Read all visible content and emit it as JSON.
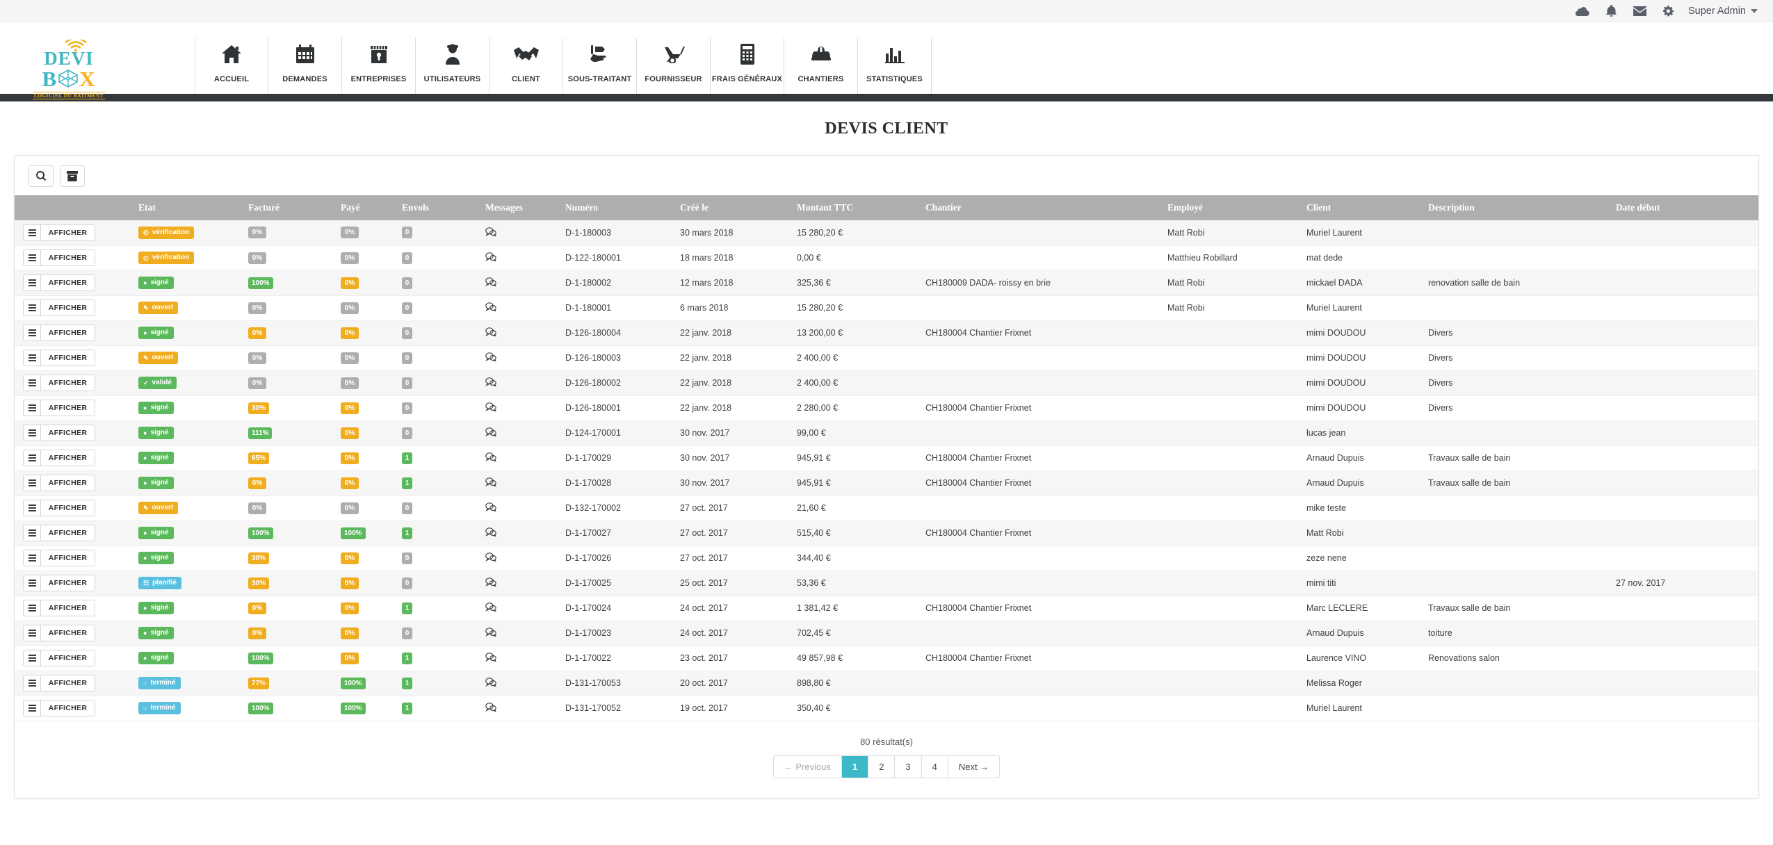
{
  "topbar": {
    "icons": [
      "cloud-icon",
      "bell-icon",
      "envelope-icon",
      "gear-icon"
    ],
    "user_label": "Super Admin"
  },
  "brand": {
    "line1": "DEVI",
    "line1_accent": "I",
    "line2_left": "B",
    "line2_right": "X",
    "tagline": "LOGICIEL DU BATIMENT"
  },
  "nav": {
    "items": [
      {
        "label": "ACCUEIL",
        "icon": "home-icon"
      },
      {
        "label": "DEMANDES",
        "icon": "calendar-icon"
      },
      {
        "label": "ENTREPRISES",
        "icon": "shop-icon"
      },
      {
        "label": "UTILISATEURS",
        "icon": "user-icon"
      },
      {
        "label": "CLIENT",
        "icon": "handshake-icon"
      },
      {
        "label": "SOUS-TRAITANT",
        "icon": "hand-tool-icon"
      },
      {
        "label": "FOURNISSEUR",
        "icon": "wheelbarrow-icon"
      },
      {
        "label": "FRAIS GÉNÉRAUX",
        "icon": "calculator-icon"
      },
      {
        "label": "CHANTIERS",
        "icon": "helmet-icon"
      },
      {
        "label": "STATISTIQUES",
        "icon": "bar-chart-icon"
      }
    ]
  },
  "page": {
    "title": "DEVIS CLIENT"
  },
  "toolbar": {
    "search_icon": "search-icon",
    "archive_icon": "archive-box-icon"
  },
  "table": {
    "columns": [
      "",
      "Etat",
      "Facturé",
      "Payé",
      "Envols",
      "Messages",
      "Numéro",
      "Créé le",
      "Montant TTC",
      "Chantier",
      "Employé",
      "Client",
      "Description",
      "Date début"
    ],
    "row_action": {
      "show_label": "AFFICHER",
      "menu_icon": "hamburger-icon"
    },
    "rows": [
      {
        "etat": "vérification",
        "etat_color": "yellow",
        "etat_icon": "clock",
        "facture": "0%",
        "facture_color": "grey",
        "paye": "0%",
        "paye_color": "grey",
        "envois": "0",
        "envois_color": "grey",
        "numero": "D-1-180003",
        "cree": "30 mars 2018",
        "montant": "15 280,20 €",
        "chantier": "",
        "employe": "Matt Robi",
        "client": "Muriel Laurent",
        "description": "",
        "date_debut": ""
      },
      {
        "etat": "vérification",
        "etat_color": "yellow",
        "etat_icon": "clock",
        "facture": "0%",
        "facture_color": "grey",
        "paye": "0%",
        "paye_color": "grey",
        "envois": "0",
        "envois_color": "grey",
        "numero": "D-122-180001",
        "cree": "18 mars 2018",
        "montant": "0,00 €",
        "chantier": "",
        "employe": "Matthieu Robillard",
        "client": "mat dede",
        "description": "",
        "date_debut": ""
      },
      {
        "etat": "signé",
        "etat_color": "green",
        "etat_icon": "dot",
        "facture": "100%",
        "facture_color": "green",
        "paye": "0%",
        "paye_color": "yellow",
        "envois": "0",
        "envois_color": "grey",
        "numero": "D-1-180002",
        "cree": "12 mars 2018",
        "montant": "325,36 €",
        "chantier": "CH180009 DADA- roissy en brie",
        "employe": "Matt Robi",
        "client": "mickael DADA",
        "description": "renovation salle de bain",
        "date_debut": ""
      },
      {
        "etat": "ouvert",
        "etat_color": "yellow",
        "etat_icon": "pencil",
        "facture": "0%",
        "facture_color": "grey",
        "paye": "0%",
        "paye_color": "grey",
        "envois": "0",
        "envois_color": "grey",
        "numero": "D-1-180001",
        "cree": "6 mars 2018",
        "montant": "15 280,20 €",
        "chantier": "",
        "employe": "Matt Robi",
        "client": "Muriel Laurent",
        "description": "",
        "date_debut": ""
      },
      {
        "etat": "signé",
        "etat_color": "green",
        "etat_icon": "dot",
        "facture": "0%",
        "facture_color": "yellow",
        "paye": "0%",
        "paye_color": "yellow",
        "envois": "0",
        "envois_color": "grey",
        "numero": "D-126-180004",
        "cree": "22 janv. 2018",
        "montant": "13 200,00 €",
        "chantier": "CH180004 Chantier Frixnet",
        "employe": "",
        "client": "mimi DOUDOU",
        "description": "Divers",
        "date_debut": ""
      },
      {
        "etat": "ouvert",
        "etat_color": "yellow",
        "etat_icon": "pencil",
        "facture": "0%",
        "facture_color": "grey",
        "paye": "0%",
        "paye_color": "grey",
        "envois": "0",
        "envois_color": "grey",
        "numero": "D-126-180003",
        "cree": "22 janv. 2018",
        "montant": "2 400,00 €",
        "chantier": "",
        "employe": "",
        "client": "mimi DOUDOU",
        "description": "Divers",
        "date_debut": ""
      },
      {
        "etat": "validé",
        "etat_color": "green",
        "etat_icon": "check",
        "facture": "0%",
        "facture_color": "grey",
        "paye": "0%",
        "paye_color": "grey",
        "envois": "0",
        "envois_color": "grey",
        "numero": "D-126-180002",
        "cree": "22 janv. 2018",
        "montant": "2 400,00 €",
        "chantier": "",
        "employe": "",
        "client": "mimi DOUDOU",
        "description": "Divers",
        "date_debut": ""
      },
      {
        "etat": "signé",
        "etat_color": "green",
        "etat_icon": "dot",
        "facture": "30%",
        "facture_color": "yellow",
        "paye": "0%",
        "paye_color": "yellow",
        "envois": "0",
        "envois_color": "grey",
        "numero": "D-126-180001",
        "cree": "22 janv. 2018",
        "montant": "2 280,00 €",
        "chantier": "CH180004 Chantier Frixnet",
        "employe": "",
        "client": "mimi DOUDOU",
        "description": "Divers",
        "date_debut": ""
      },
      {
        "etat": "signé",
        "etat_color": "green",
        "etat_icon": "dot",
        "facture": "111%",
        "facture_color": "green",
        "paye": "0%",
        "paye_color": "yellow",
        "envois": "0",
        "envois_color": "grey",
        "numero": "D-124-170001",
        "cree": "30 nov. 2017",
        "montant": "99,00 €",
        "chantier": "",
        "employe": "",
        "client": "lucas jean",
        "description": "",
        "date_debut": ""
      },
      {
        "etat": "signé",
        "etat_color": "green",
        "etat_icon": "dot",
        "facture": "65%",
        "facture_color": "yellow",
        "paye": "0%",
        "paye_color": "yellow",
        "envois": "1",
        "envois_color": "green",
        "numero": "D-1-170029",
        "cree": "30 nov. 2017",
        "montant": "945,91 €",
        "chantier": "CH180004 Chantier Frixnet",
        "employe": "",
        "client": "Arnaud Dupuis",
        "description": "Travaux salle de bain",
        "date_debut": ""
      },
      {
        "etat": "signé",
        "etat_color": "green",
        "etat_icon": "dot",
        "facture": "0%",
        "facture_color": "yellow",
        "paye": "0%",
        "paye_color": "yellow",
        "envois": "1",
        "envois_color": "green",
        "numero": "D-1-170028",
        "cree": "30 nov. 2017",
        "montant": "945,91 €",
        "chantier": "CH180004 Chantier Frixnet",
        "employe": "",
        "client": "Arnaud Dupuis",
        "description": "Travaux salle de bain",
        "date_debut": ""
      },
      {
        "etat": "ouvert",
        "etat_color": "yellow",
        "etat_icon": "pencil",
        "facture": "0%",
        "facture_color": "grey",
        "paye": "0%",
        "paye_color": "grey",
        "envois": "0",
        "envois_color": "grey",
        "numero": "D-132-170002",
        "cree": "27 oct. 2017",
        "montant": "21,60 €",
        "chantier": "",
        "employe": "",
        "client": "mike teste",
        "description": "",
        "date_debut": ""
      },
      {
        "etat": "signé",
        "etat_color": "green",
        "etat_icon": "dot",
        "facture": "100%",
        "facture_color": "green",
        "paye": "100%",
        "paye_color": "green",
        "envois": "1",
        "envois_color": "green",
        "numero": "D-1-170027",
        "cree": "27 oct. 2017",
        "montant": "515,40 €",
        "chantier": "CH180004 Chantier Frixnet",
        "employe": "",
        "client": "Matt Robi",
        "description": "",
        "date_debut": ""
      },
      {
        "etat": "signé",
        "etat_color": "green",
        "etat_icon": "dot",
        "facture": "30%",
        "facture_color": "yellow",
        "paye": "0%",
        "paye_color": "yellow",
        "envois": "0",
        "envois_color": "grey",
        "numero": "D-1-170026",
        "cree": "27 oct. 2017",
        "montant": "344,40 €",
        "chantier": "",
        "employe": "",
        "client": "zeze nene",
        "description": "",
        "date_debut": ""
      },
      {
        "etat": "planifié",
        "etat_color": "blue",
        "etat_icon": "calendar",
        "facture": "30%",
        "facture_color": "yellow",
        "paye": "0%",
        "paye_color": "yellow",
        "envois": "0",
        "envois_color": "grey",
        "numero": "D-1-170025",
        "cree": "25 oct. 2017",
        "montant": "53,36 €",
        "chantier": "",
        "employe": "",
        "client": "mimi titi",
        "description": "",
        "date_debut": "27 nov. 2017"
      },
      {
        "etat": "signé",
        "etat_color": "green",
        "etat_icon": "dot",
        "facture": "0%",
        "facture_color": "yellow",
        "paye": "0%",
        "paye_color": "yellow",
        "envois": "1",
        "envois_color": "green",
        "numero": "D-1-170024",
        "cree": "24 oct. 2017",
        "montant": "1 381,42 €",
        "chantier": "CH180004 Chantier Frixnet",
        "employe": "",
        "client": "Marc LECLERE",
        "description": "Travaux salle de bain",
        "date_debut": ""
      },
      {
        "etat": "signé",
        "etat_color": "green",
        "etat_icon": "dot",
        "facture": "0%",
        "facture_color": "yellow",
        "paye": "0%",
        "paye_color": "yellow",
        "envois": "0",
        "envois_color": "grey",
        "numero": "D-1-170023",
        "cree": "24 oct. 2017",
        "montant": "702,45 €",
        "chantier": "",
        "employe": "",
        "client": "Arnaud Dupuis",
        "description": "toiture",
        "date_debut": ""
      },
      {
        "etat": "signé",
        "etat_color": "green",
        "etat_icon": "dot",
        "facture": "100%",
        "facture_color": "green",
        "paye": "0%",
        "paye_color": "yellow",
        "envois": "1",
        "envois_color": "green",
        "numero": "D-1-170022",
        "cree": "23 oct. 2017",
        "montant": "49 857,98 €",
        "chantier": "CH180004 Chantier Frixnet",
        "employe": "",
        "client": "Laurence VINO",
        "description": "Renovations salon",
        "date_debut": ""
      },
      {
        "etat": "terminé",
        "etat_color": "blue",
        "etat_icon": "circle",
        "facture": "77%",
        "facture_color": "yellow",
        "paye": "100%",
        "paye_color": "green",
        "envois": "1",
        "envois_color": "green",
        "numero": "D-131-170053",
        "cree": "20 oct. 2017",
        "montant": "898,80 €",
        "chantier": "",
        "employe": "",
        "client": "Melissa Roger",
        "description": "",
        "date_debut": ""
      },
      {
        "etat": "terminé",
        "etat_color": "blue",
        "etat_icon": "circle",
        "facture": "100%",
        "facture_color": "green",
        "paye": "100%",
        "paye_color": "green",
        "envois": "1",
        "envois_color": "green",
        "numero": "D-131-170052",
        "cree": "19 oct. 2017",
        "montant": "350,40 €",
        "chantier": "",
        "employe": "",
        "client": "Muriel Laurent",
        "description": "",
        "date_debut": ""
      }
    ]
  },
  "footer": {
    "results_text": "80 résultat(s)",
    "pager": [
      {
        "label": "← Previous",
        "state": "muted"
      },
      {
        "label": "1",
        "state": "active"
      },
      {
        "label": "2",
        "state": "normal"
      },
      {
        "label": "3",
        "state": "normal"
      },
      {
        "label": "4",
        "state": "normal"
      },
      {
        "label": "Next →",
        "state": "normal"
      }
    ]
  },
  "colors": {
    "accent_teal": "#3bb9c8",
    "brand_yellow": "#f5b11e",
    "badge_yellow": "#f0ad20",
    "badge_green": "#5cb85c",
    "badge_grey": "#aeaeae",
    "badge_blue": "#5bc0de",
    "header_grey": "#aeaeae",
    "dark_bar": "#33383c"
  }
}
